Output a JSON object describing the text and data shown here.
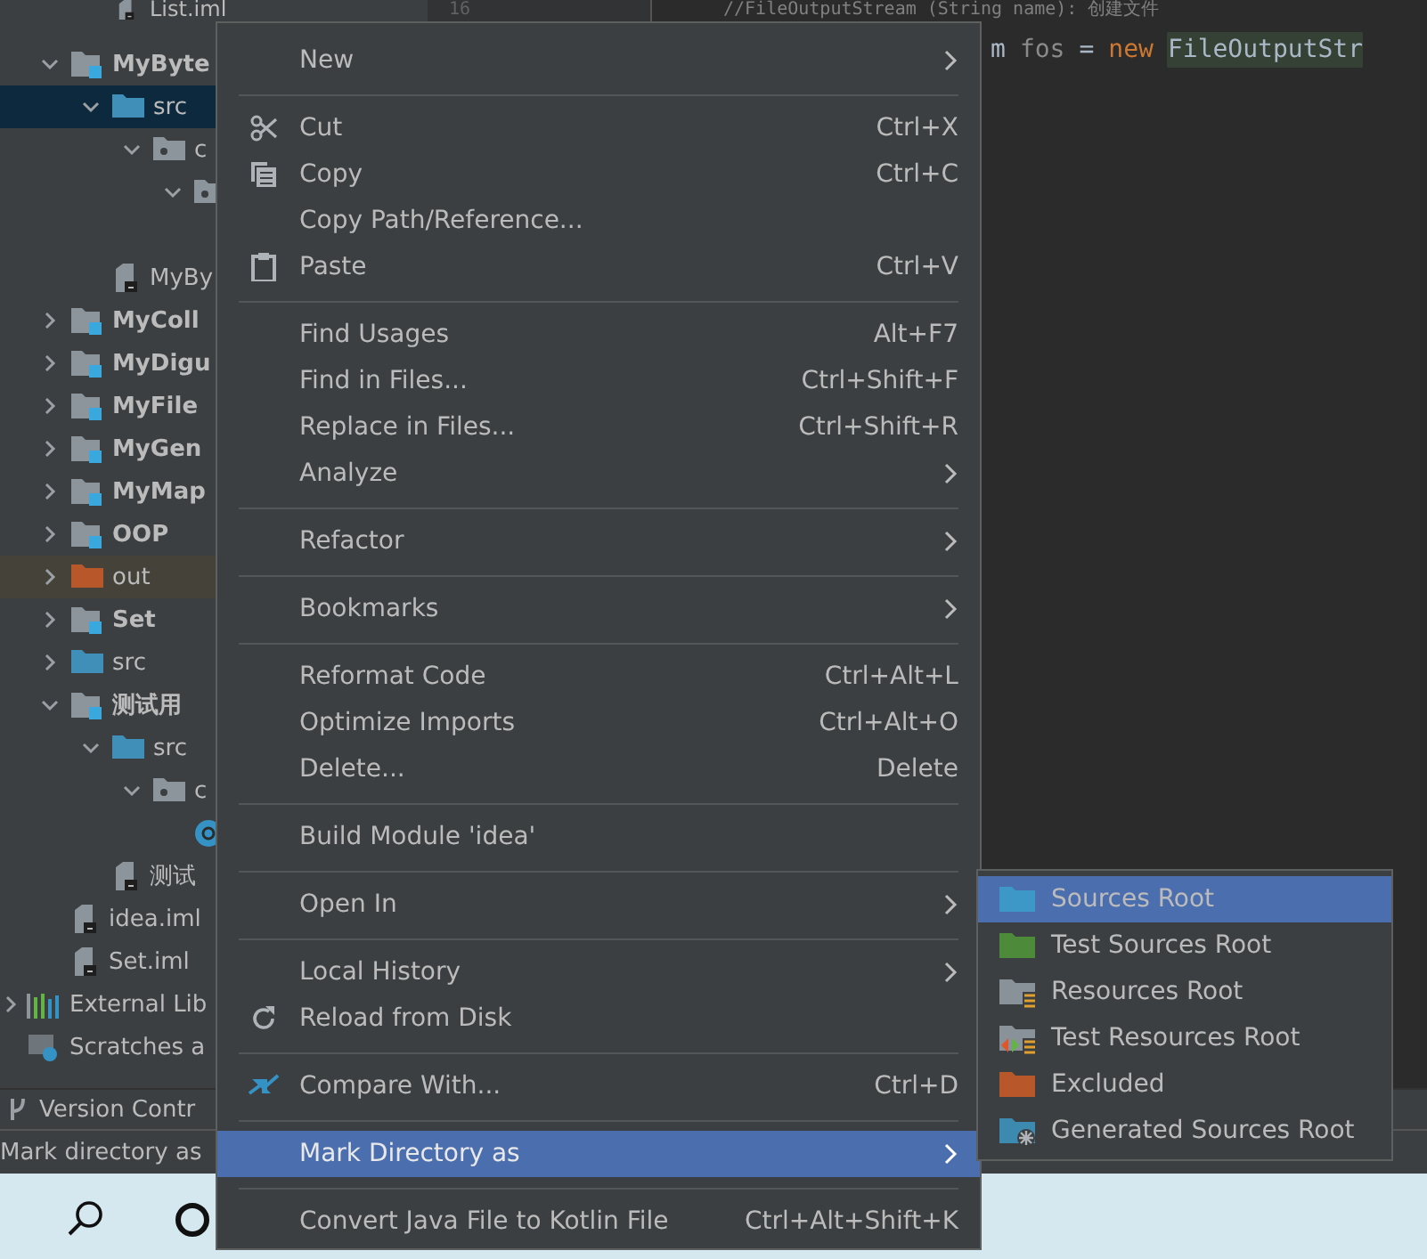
{
  "tree_top": [
    {
      "kind": "file",
      "name": "List.iml"
    }
  ],
  "tree": [
    {
      "kind": "module",
      "name": "MyByte",
      "expanded": true,
      "selected": false,
      "children": [
        {
          "kind": "source",
          "name": "src",
          "expanded": true,
          "selected": true,
          "children": [
            {
              "kind": "package",
              "name": "c",
              "expanded": true,
              "selected": false,
              "children": [
                {
                  "kind": "package",
                  "expanded": true,
                  "selected": false,
                  "children": [
                    {
                      "kind": "gap"
                    }
                  ]
                }
              ]
            }
          ]
        },
        {
          "kind": "file",
          "name": "MyBy",
          "selected": false
        }
      ]
    },
    {
      "kind": "module",
      "name": "MyColl",
      "expanded": false,
      "selected": false
    },
    {
      "kind": "module",
      "name": "MyDigu",
      "expanded": false,
      "selected": false
    },
    {
      "kind": "module",
      "name": "MyFile",
      "expanded": false,
      "selected": false
    },
    {
      "kind": "module",
      "name": "MyGen",
      "expanded": false,
      "selected": false
    },
    {
      "kind": "module",
      "name": "MyMap",
      "expanded": false,
      "selected": false
    },
    {
      "kind": "module",
      "name": "OOP",
      "expanded": false,
      "selected": false
    },
    {
      "kind": "excluded",
      "name": "out",
      "expanded": false,
      "selected": false
    },
    {
      "kind": "module",
      "name": "Set",
      "expanded": false,
      "selected": false
    },
    {
      "kind": "source",
      "name": "src",
      "expanded": false,
      "selected": false
    },
    {
      "kind": "module",
      "name": "测试用",
      "expanded": true,
      "selected": false,
      "children": [
        {
          "kind": "source",
          "name": "src",
          "expanded": true,
          "selected": false,
          "children": [
            {
              "kind": "package",
              "name": "c",
              "expanded": true,
              "selected": false,
              "children": [
                {
                  "kind": "class",
                  "selected": false
                }
              ]
            }
          ]
        },
        {
          "kind": "file",
          "name": "测试",
          "selected": false
        }
      ]
    },
    {
      "kind": "file",
      "name": "idea.iml",
      "selected": false
    },
    {
      "kind": "file",
      "name": "Set.iml",
      "selected": false
    }
  ],
  "tree_footer": [
    {
      "kind": "libraries",
      "name": "External Lib"
    },
    {
      "kind": "scratches",
      "name": "Scratches a"
    }
  ],
  "editor": {
    "line_number": "16",
    "comment": "//FileOutputStream (String name): 创建文件",
    "tokens": [
      {
        "kind": "plain",
        "text": "m"
      },
      {
        "kind": "var",
        "text": "fos"
      },
      {
        "kind": "plain",
        "text": "="
      },
      {
        "kind": "keyword",
        "text": "new"
      },
      {
        "kind": "type",
        "text": "FileOutputStr"
      }
    ]
  },
  "tool_bar": {
    "label": "Version Contr"
  },
  "status_bar": "Mark directory as",
  "context_menu": [
    {
      "kind": "submenu",
      "label": "New",
      "selected": false
    },
    {
      "kind": "separator"
    },
    {
      "kind": "cut",
      "label": "Cut",
      "shortcut": "Ctrl+X",
      "selected": false
    },
    {
      "kind": "copy",
      "label": "Copy",
      "shortcut": "Ctrl+C",
      "selected": false
    },
    {
      "kind": "plain",
      "label": "Copy Path/Reference...",
      "selected": false
    },
    {
      "kind": "paste",
      "label": "Paste",
      "shortcut": "Ctrl+V",
      "selected": false
    },
    {
      "kind": "separator"
    },
    {
      "kind": "plain",
      "label": "Find Usages",
      "shortcut": "Alt+F7",
      "selected": false
    },
    {
      "kind": "plain",
      "label": "Find in Files...",
      "shortcut": "Ctrl+Shift+F",
      "selected": false
    },
    {
      "kind": "plain",
      "label": "Replace in Files...",
      "shortcut": "Ctrl+Shift+R",
      "selected": false
    },
    {
      "kind": "submenu",
      "label": "Analyze",
      "selected": false
    },
    {
      "kind": "separator"
    },
    {
      "kind": "submenu",
      "label": "Refactor",
      "selected": false
    },
    {
      "kind": "separator"
    },
    {
      "kind": "submenu",
      "label": "Bookmarks",
      "selected": false
    },
    {
      "kind": "separator"
    },
    {
      "kind": "plain",
      "label": "Reformat Code",
      "shortcut": "Ctrl+Alt+L",
      "selected": false
    },
    {
      "kind": "plain",
      "label": "Optimize Imports",
      "shortcut": "Ctrl+Alt+O",
      "selected": false
    },
    {
      "kind": "plain",
      "label": "Delete...",
      "shortcut": "Delete",
      "selected": false
    },
    {
      "kind": "separator"
    },
    {
      "kind": "plain",
      "label": "Build Module 'idea'",
      "selected": false
    },
    {
      "kind": "separator"
    },
    {
      "kind": "submenu",
      "label": "Open In",
      "selected": false
    },
    {
      "kind": "separator"
    },
    {
      "kind": "submenu",
      "label": "Local History",
      "selected": false
    },
    {
      "kind": "reload",
      "label": "Reload from Disk",
      "selected": false
    },
    {
      "kind": "separator"
    },
    {
      "kind": "compare",
      "label": "Compare With...",
      "shortcut": "Ctrl+D",
      "selected": false
    },
    {
      "kind": "separator"
    },
    {
      "kind": "submenu",
      "label": "Mark Directory as",
      "selected": true
    },
    {
      "kind": "separator"
    },
    {
      "kind": "plain",
      "label": "Convert Java File to Kotlin File",
      "shortcut": "Ctrl+Alt+Shift+K",
      "selected": false
    }
  ],
  "submenu": [
    {
      "kind": "source",
      "label": "Sources Root",
      "selected": true
    },
    {
      "kind": "test-source",
      "label": "Test Sources Root",
      "selected": false
    },
    {
      "kind": "resources",
      "label": "Resources Root",
      "selected": false
    },
    {
      "kind": "test-resources",
      "label": "Test Resources Root",
      "selected": false
    },
    {
      "kind": "excluded",
      "label": "Excluded",
      "selected": false
    },
    {
      "kind": "generated",
      "label": "Generated Sources Root",
      "selected": false
    }
  ]
}
